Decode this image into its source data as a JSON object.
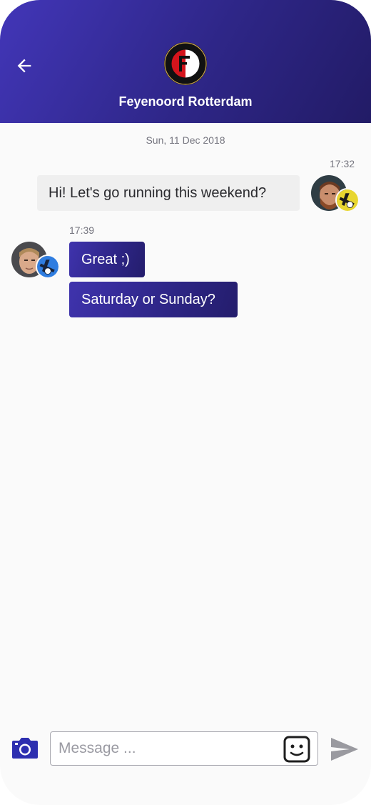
{
  "header": {
    "back_icon": "arrow-left-icon",
    "logo_icon": "feyenoord-crest-icon",
    "title": "Feyenoord Rotterdam",
    "colors": {
      "gradient_start": "#4236b8",
      "gradient_end": "#221b66"
    }
  },
  "conversation": {
    "date": "Sun, 11 Dec 2018",
    "incoming": {
      "time": "17:32",
      "messages": [
        {
          "text": "Hi! Let's go running this weekend?"
        }
      ]
    },
    "outgoing": {
      "time": "17:39",
      "messages": [
        {
          "text": "Great ;)"
        },
        {
          "text": "Saturday or Sunday?"
        }
      ]
    },
    "colors": {
      "incoming_bubble": "#efefef",
      "outgoing_bubble": "#3f33ad"
    }
  },
  "composer": {
    "camera_icon": "camera-icon",
    "placeholder": "Message ...",
    "value": "",
    "emoji_icon": "emoji-icon",
    "send_icon": "send-icon"
  }
}
